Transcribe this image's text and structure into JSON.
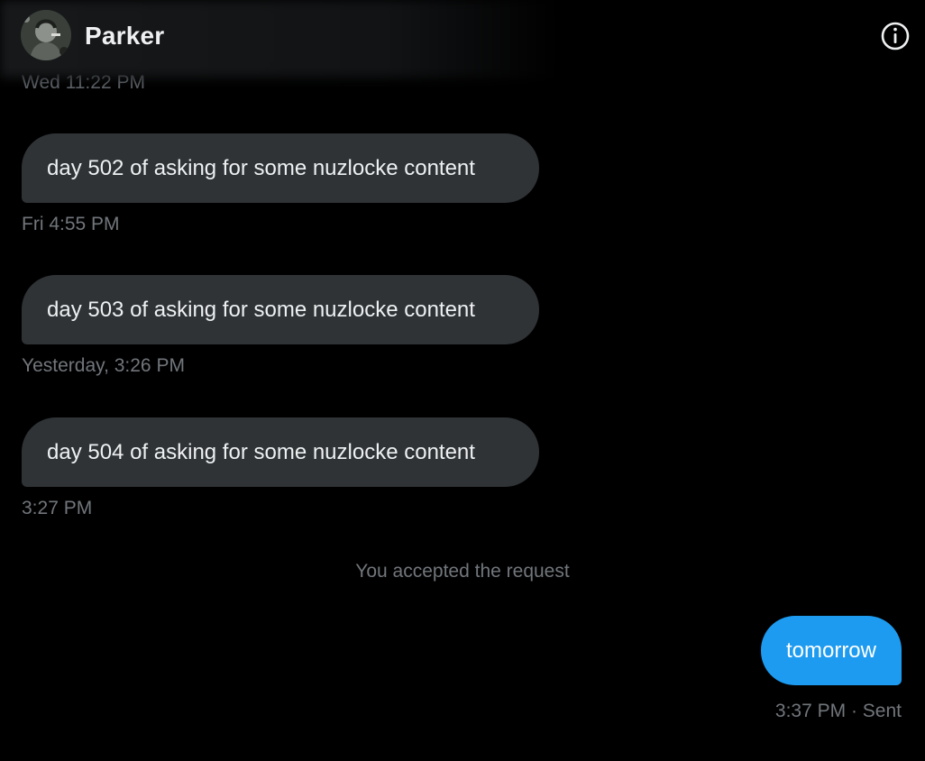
{
  "header": {
    "contact_name": "Parker",
    "avatar_icon": "user-avatar",
    "info_icon": "info-circle-icon"
  },
  "messages": [
    {
      "timestamp_above": "Wed 11:22 PM"
    },
    {
      "text": "day 502 of asking for some nuzlocke content",
      "timestamp": "Fri 4:55 PM"
    },
    {
      "text": "day 503 of asking for some nuzlocke content",
      "timestamp": "Yesterday, 3:26 PM"
    },
    {
      "text": "day 504 of asking for some nuzlocke content",
      "timestamp": "3:27 PM"
    }
  ],
  "system_note": "You accepted the request",
  "sent": {
    "text": "tomorrow",
    "meta": "3:37 PM · Sent"
  },
  "colors": {
    "background": "#000000",
    "received_bubble": "#2f3336",
    "sent_bubble": "#1d9bf0",
    "muted_text": "#71767b"
  }
}
